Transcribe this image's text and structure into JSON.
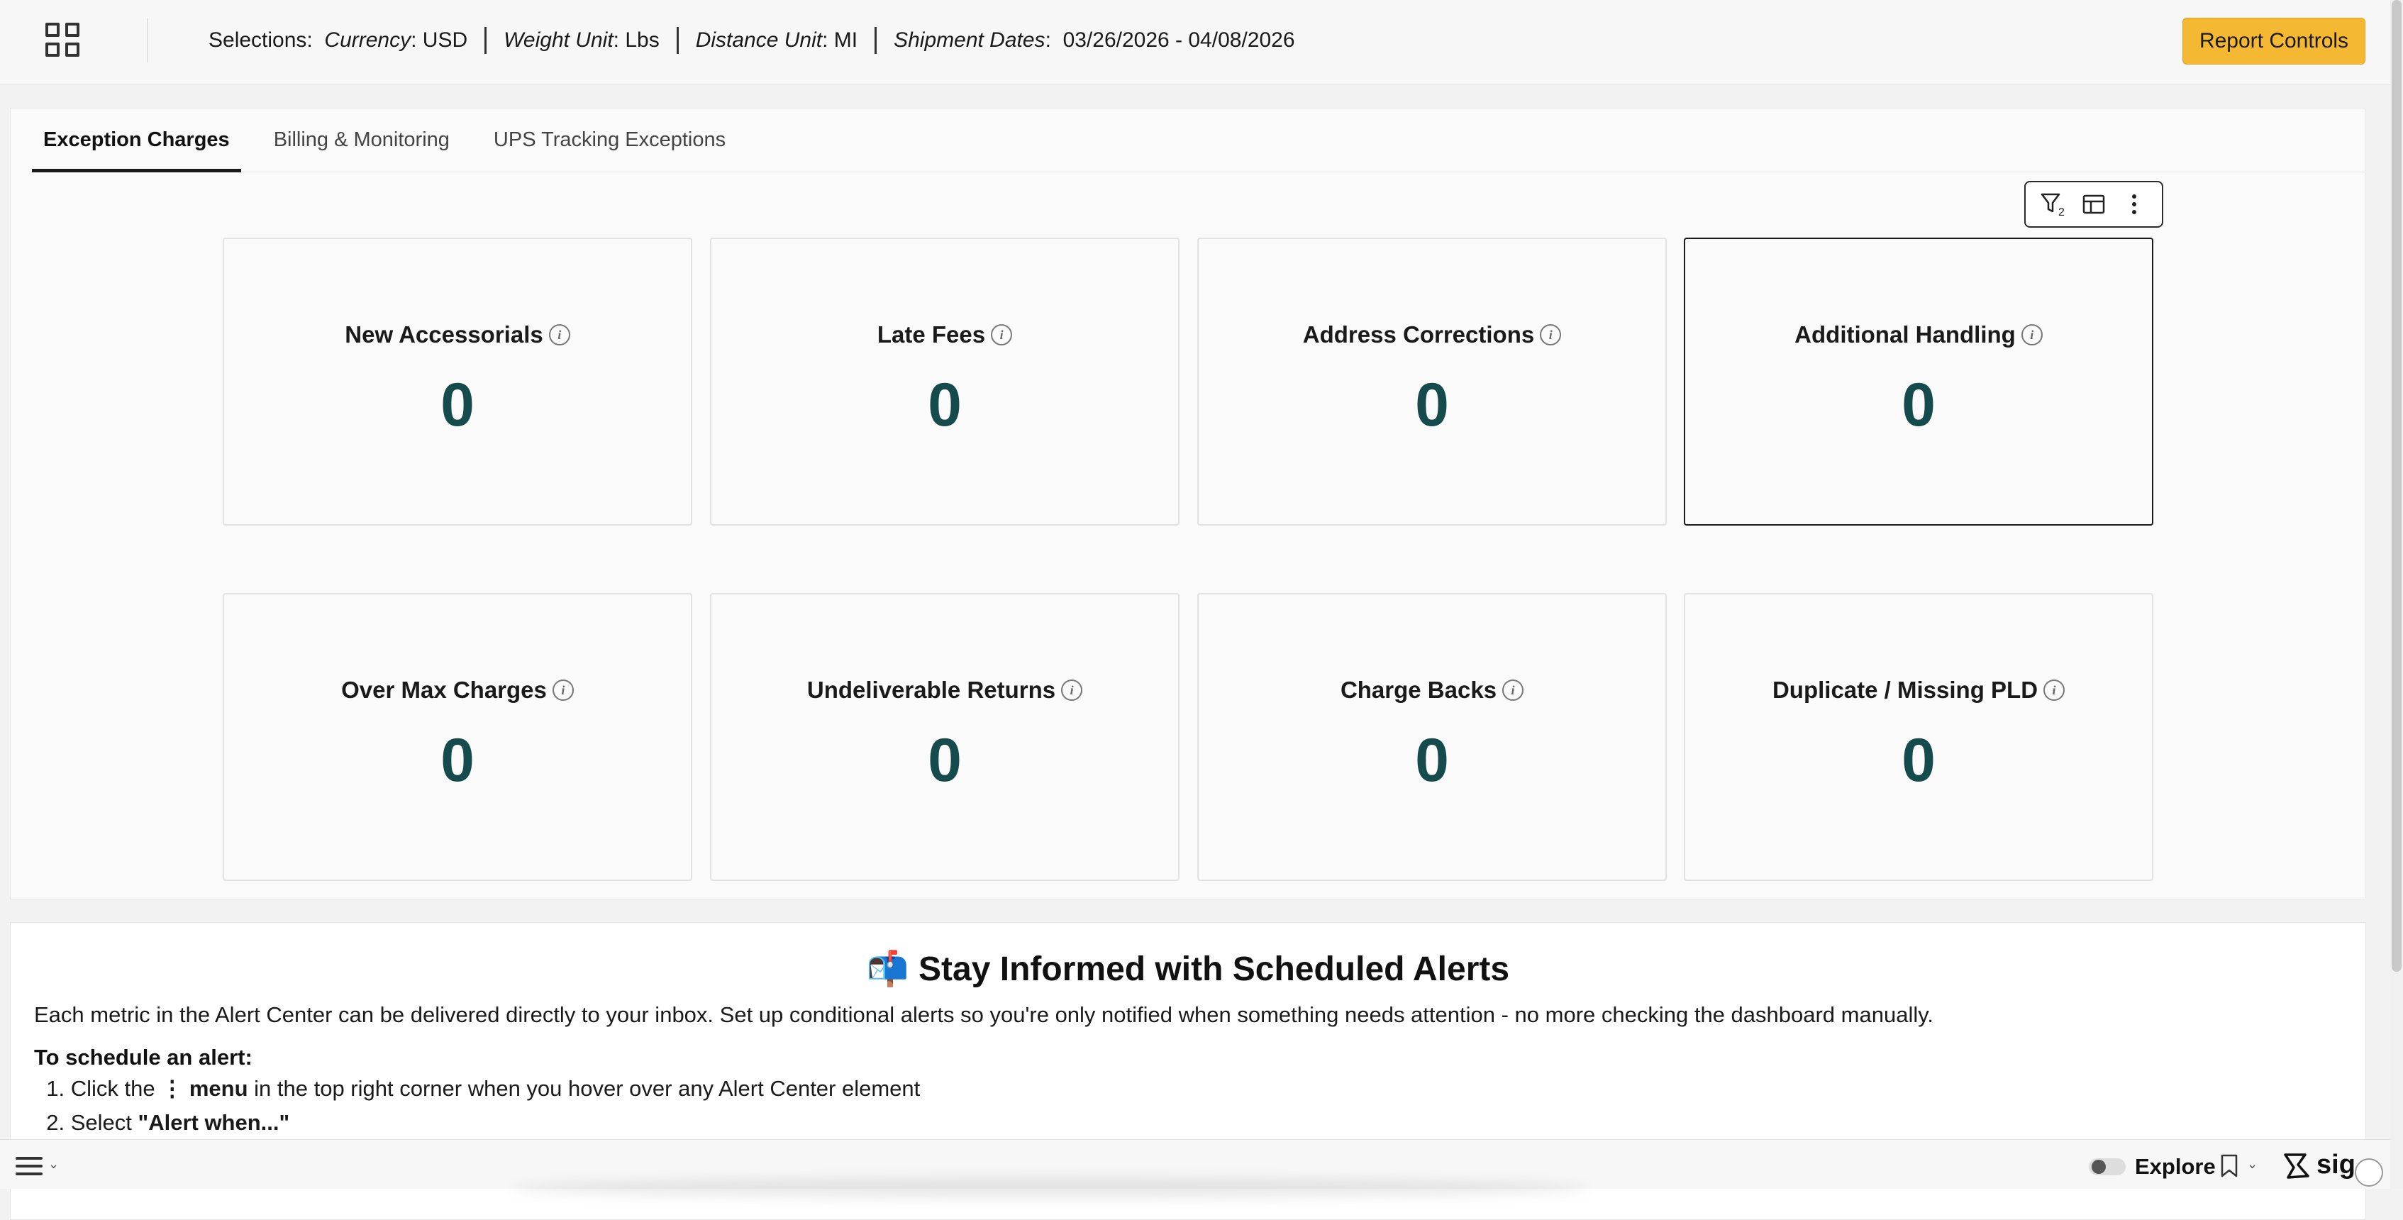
{
  "topbar": {
    "selections_label": "Selections:",
    "currency_label": "Currency",
    "currency_value": ": USD",
    "weight_label": "Weight Unit",
    "weight_value": ": Lbs",
    "distance_label": "Distance Unit",
    "distance_value": ": MI",
    "dates_label": "Shipment Dates",
    "dates_value": ":  03/26/2026 - 04/08/2026",
    "report_controls_label": "Report Controls"
  },
  "tabs": [
    {
      "label": "Exception Charges",
      "active": true
    },
    {
      "label": "Billing & Monitoring",
      "active": false
    },
    {
      "label": "UPS Tracking Exceptions",
      "active": false
    }
  ],
  "toolbar": {
    "filter_count": "2"
  },
  "metrics": [
    {
      "title": "New Accessorials",
      "value": "0"
    },
    {
      "title": "Late Fees",
      "value": "0"
    },
    {
      "title": "Address Corrections",
      "value": "0"
    },
    {
      "title": "Additional Handling",
      "value": "0"
    },
    {
      "title": "Over Max Charges",
      "value": "0"
    },
    {
      "title": "Undeliverable Returns",
      "value": "0"
    },
    {
      "title": "Charge Backs",
      "value": "0"
    },
    {
      "title": "Duplicate / Missing PLD",
      "value": "0"
    }
  ],
  "alerts": {
    "title_emoji": "📬",
    "title": "Stay Informed with Scheduled Alerts",
    "description": "Each metric in the Alert Center can be delivered directly to your inbox. Set up conditional alerts so you're only notified when something needs attention - no more checking the dashboard manually.",
    "subheading": "To schedule an alert:",
    "step1_prefix": "Click the",
    "step1_menu_glyph": "⋮",
    "step1_menu": "menu",
    "step1_suffix": "in the top right corner when you hover over any Alert Center element",
    "step2_prefix": "Select",
    "step2_bold": "\"Alert when...\""
  },
  "bottombar": {
    "explore_label": "Explore",
    "logo_text": "sig"
  },
  "colors": {
    "accent": "#f5b833",
    "metric_value": "#154b4d"
  }
}
